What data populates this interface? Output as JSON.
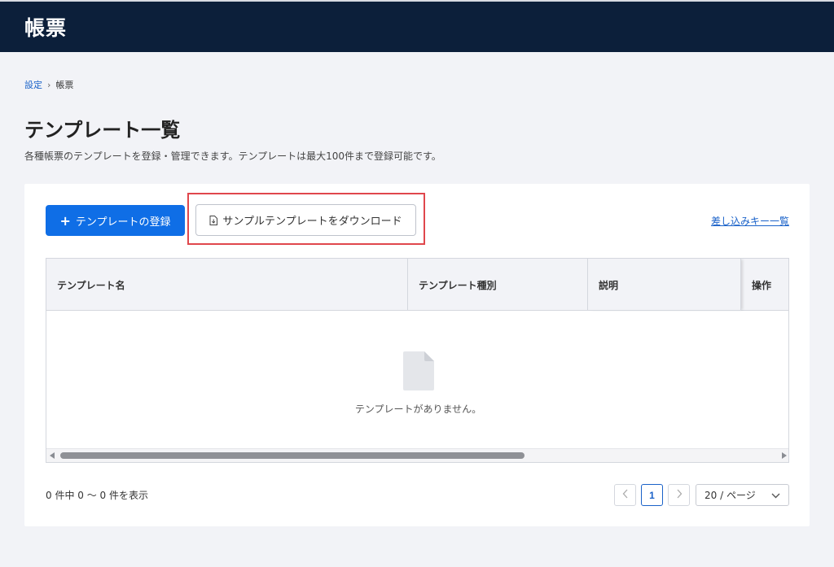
{
  "header": {
    "title": "帳票"
  },
  "breadcrumb": {
    "parent": "設定",
    "separator": "›",
    "current": "帳票"
  },
  "page": {
    "title": "テンプレート一覧",
    "description": "各種帳票のテンプレートを登録・管理できます。テンプレートは最大100件まで登録可能です。"
  },
  "toolbar": {
    "register_label": "テンプレートの登録",
    "download_label": "サンプルテンプレートをダウンロード",
    "keys_link": "差し込みキー一覧"
  },
  "table": {
    "columns": [
      "テンプレート名",
      "テンプレート種別",
      "説明",
      "操作"
    ],
    "empty_text": "テンプレートがありません。"
  },
  "footer": {
    "count_text": "0 件中 0 ～ 0 件を表示",
    "current_page": "1",
    "per_page": "20 / ページ"
  },
  "colors": {
    "header_bg": "#0c1f3a",
    "primary": "#0f6ee6",
    "highlight": "#e0474c",
    "link": "#1a62c9"
  }
}
